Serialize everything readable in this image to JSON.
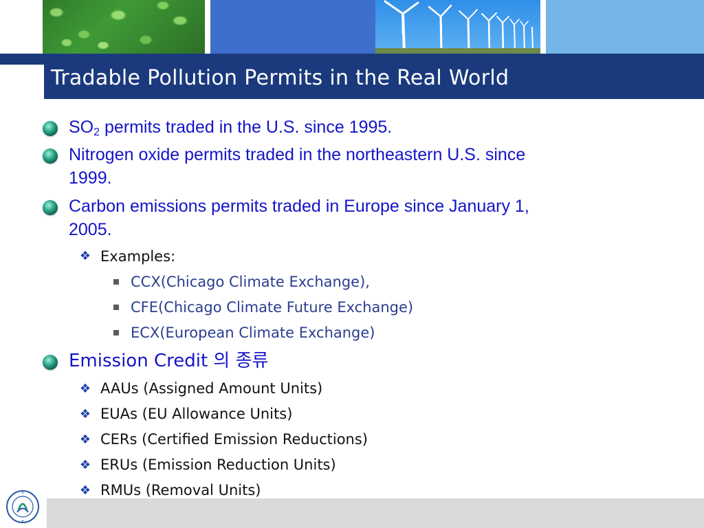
{
  "slide": {
    "title": "Tradable Pollution Permits in the Real World",
    "bullets": [
      {
        "text_main": "SO",
        "subscript": "2",
        "text_rest": " permits traded in the U.S. since 1995."
      },
      {
        "line1": "Nitrogen oxide permits traded in the northeastern U.S. since",
        "line2": "1999."
      },
      {
        "line1": "Carbon emissions permits traded in Europe since January 1,",
        "line2": "2005."
      }
    ],
    "examples_label": "Examples:",
    "exchanges": [
      "CCX(Chicago Climate Exchange),",
      "CFE(Chicago Climate Future Exchange)",
      "ECX(European Climate Exchange)"
    ],
    "credit_heading": "Emission Credit 의 종류",
    "credit_types": [
      "AAUs (Assigned Amount Units)",
      "EUAs (EU Allowance Units)",
      "CERs (Certified Emission Reductions)",
      "ERUs (Emission Reduction Units)",
      "RMUs (Removal Units)"
    ]
  },
  "colors": {
    "title_bar": "#1b3a7d",
    "level1_text": "#1414c8",
    "level3_text": "#2b3d8f",
    "footer": "#d9d9d9"
  },
  "icons": {
    "level1_bullet": "teal-orb-icon",
    "level2_bullet": "diamond-cluster-icon",
    "level3_bullet": "square-icon",
    "university_logo": "university-seal-icon"
  }
}
